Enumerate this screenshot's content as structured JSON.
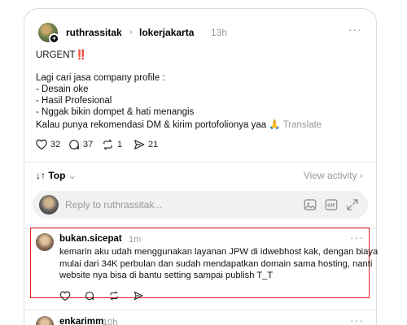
{
  "post": {
    "username": "ruthrassitak",
    "community": "lokerjakarta",
    "time": "13h",
    "more_label": "···",
    "urgent_text": "URGENT",
    "urgent_mark": "‼️",
    "body_lines": [
      "Lagi cari jasa company profile :",
      "- Desain oke",
      "- Hasil Profesional",
      "- Nggak bikin dompet & hati menangis"
    ],
    "recommend_text": "Kalau punya rekomendasi DM & kirim portofolionya yaa 🙏",
    "translate_label": "Translate",
    "likes": "32",
    "replies": "37",
    "reposts": "1",
    "shares": "21"
  },
  "thread": {
    "sort_label": "Top",
    "view_activity_label": "View activity",
    "reply_placeholder": "Reply to ruthrassitak..."
  },
  "comments": [
    {
      "username": "bukan.sicepat",
      "time": "1m",
      "more_label": "···",
      "text_lines": [
        "kemarin aku udah menggunakan layanan JPW di idwebhost kak, dengan biaya",
        "mulai dari 34K perbulan dan sudah mendapatkan domain sama hosting, nanti",
        "website nya bisa di bantu setting sampai publish T_T"
      ]
    },
    {
      "username": "enkarimm",
      "time": "10h",
      "more_label": "···"
    }
  ],
  "colors": {
    "highlight_border": "#e02020",
    "muted_text": "#999999",
    "reply_bg": "#f1f1f1"
  },
  "icons": [
    "plus-badge-icon",
    "chevron-right-icon",
    "heart-icon",
    "comment-icon",
    "repost-icon",
    "share-icon",
    "sort-icon",
    "chevron-down-icon",
    "image-icon",
    "gif-icon",
    "expand-icon",
    "more-icon"
  ]
}
